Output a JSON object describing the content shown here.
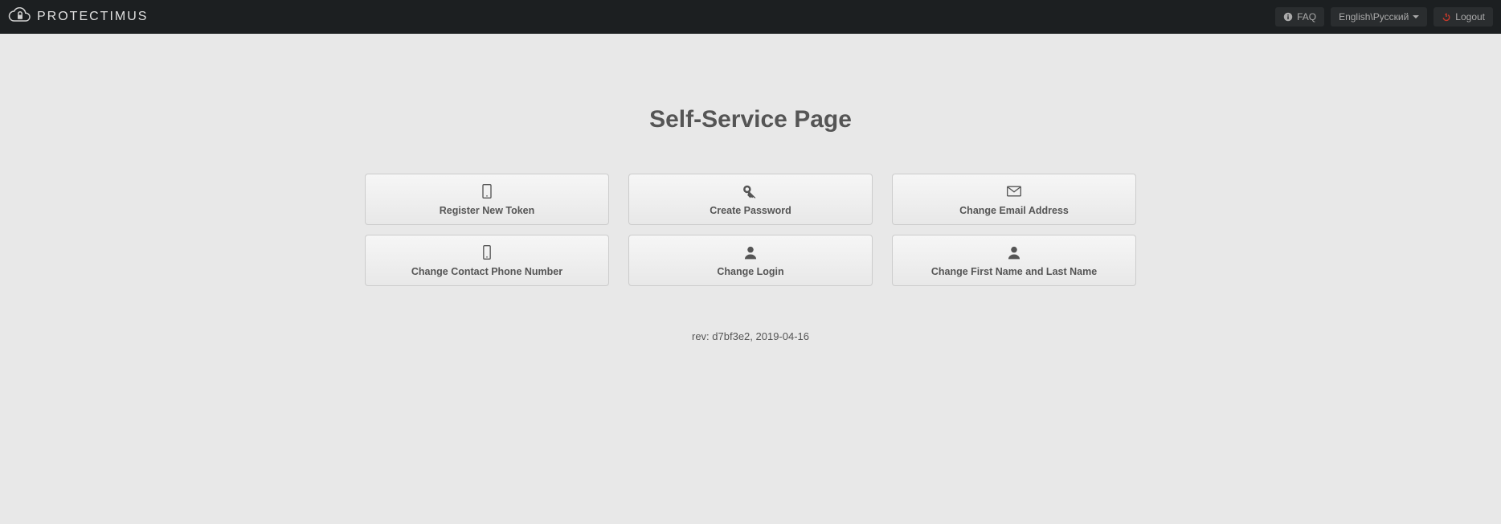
{
  "brand": "PROTECTIMUS",
  "header": {
    "faq": "FAQ",
    "language": "English\\Русский",
    "logout": "Logout"
  },
  "page": {
    "title": "Self-Service Page"
  },
  "tiles": [
    {
      "label": "Register New Token"
    },
    {
      "label": "Create Password"
    },
    {
      "label": "Change Email Address"
    },
    {
      "label": "Change Contact Phone Number"
    },
    {
      "label": "Change Login"
    },
    {
      "label": "Change First Name and Last Name"
    }
  ],
  "footer": {
    "rev": "rev: d7bf3e2, 2019-04-16"
  }
}
